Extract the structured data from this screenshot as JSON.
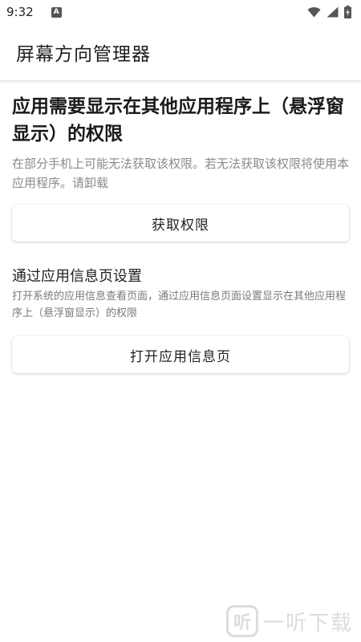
{
  "status_bar": {
    "time": "9:32",
    "notification_icon": "A"
  },
  "app_bar": {
    "title": "屏幕方向管理器"
  },
  "permission": {
    "title": "应用需要显示在其他应用程序上（悬浮窗显示）的权限",
    "description": "在部分手机上可能无法获取该权限。若无法获取该权限将使用本应用程序。请卸载",
    "button_label": "获取权限"
  },
  "app_info": {
    "title": "通过应用信息页设置",
    "description": "打开系统的应用信息查看页面，通过应用信息页面设置显示在其他应用程序上（悬浮窗显示）的权限",
    "button_label": "打开应用信息页"
  },
  "watermark": {
    "logo_glyph": "听",
    "text": "一听下载"
  },
  "colors": {
    "background": "#ffffff",
    "title_text": "#1a1a1a",
    "secondary_text": "#8a8a8a"
  }
}
